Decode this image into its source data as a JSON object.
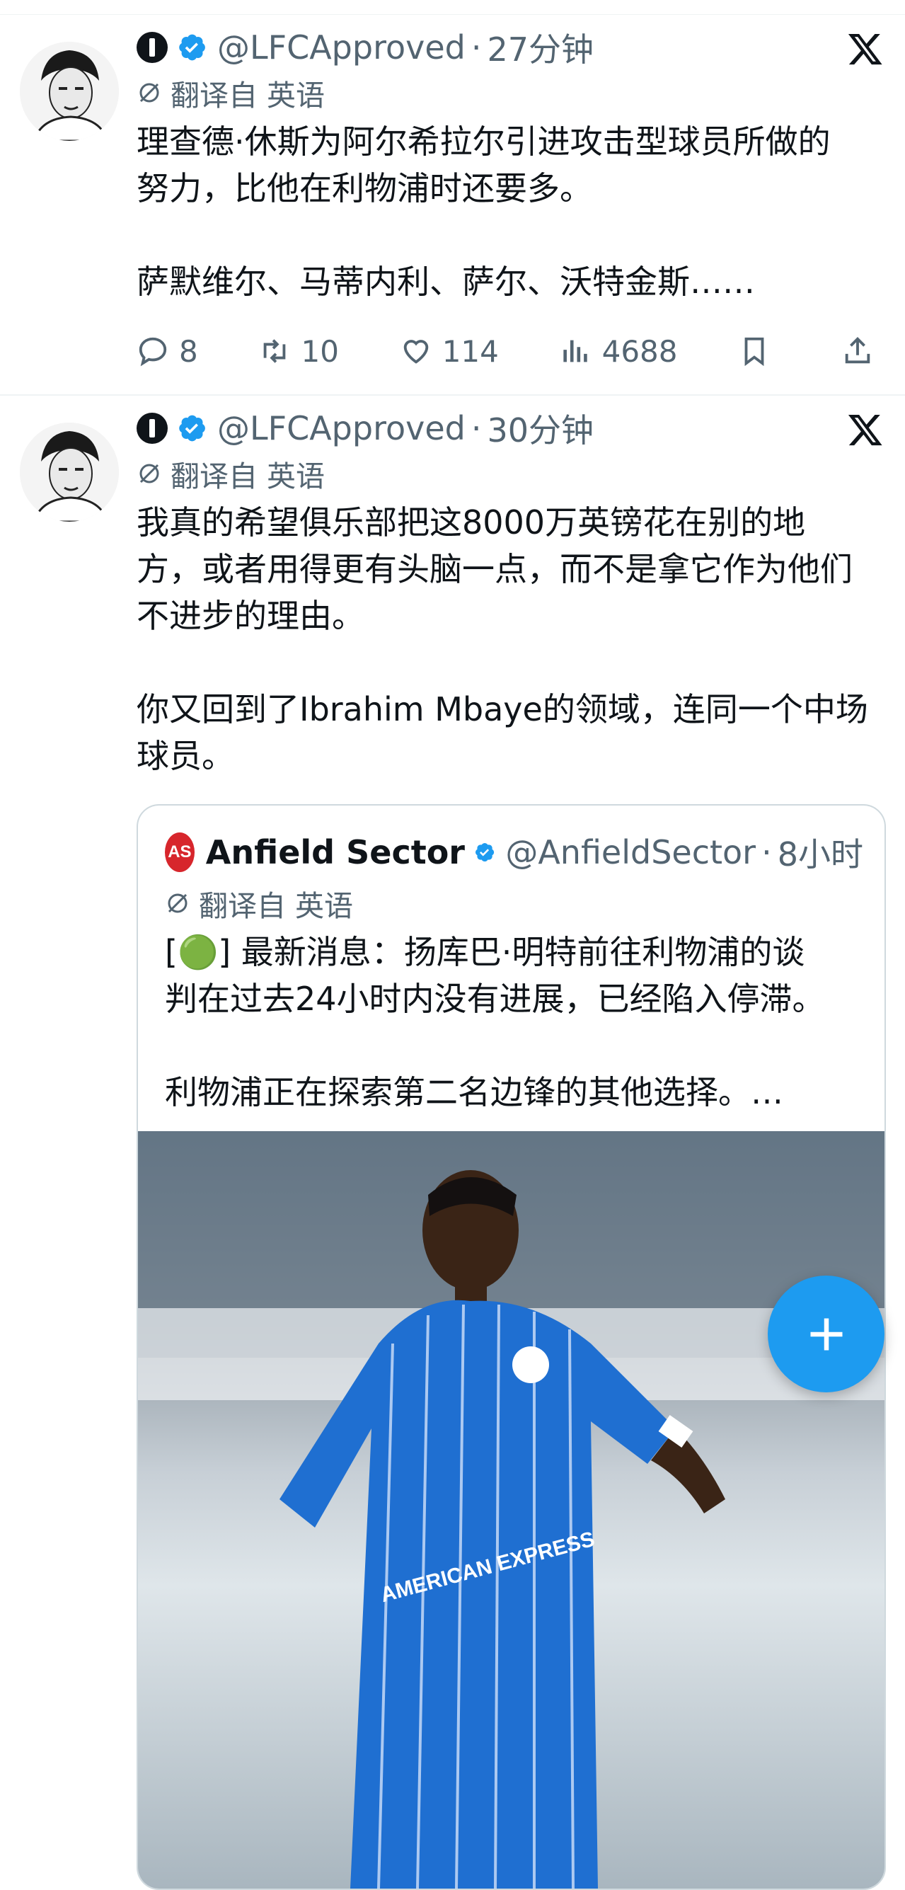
{
  "tweets": [
    {
      "handle": "@LFCApproved",
      "time": "27分钟",
      "translated": "翻译自 英语",
      "text": "理查德·休斯为阿尔希拉尔引进攻击型球员所做的\n努力，比他在利物浦时还要多。\n\n萨默维尔、马蒂内利、萨尔、沃特金斯……",
      "stats": {
        "replies": "8",
        "retweets": "10",
        "likes": "114",
        "views": "4688"
      }
    },
    {
      "handle": "@LFCApproved",
      "time": "30分钟",
      "translated": "翻译自 英语",
      "text": "我真的希望俱乐部把这8000万英镑花在别的地\n方，或者用得更有头脑一点，而不是拿它作为他们\n不进步的理由。\n\n你又回到了Ibrahim Mbaye的领域，连同一个中场\n球员。",
      "quote": {
        "logo_text": "AS",
        "name": "Anfield Sector",
        "handle": "@AnfieldSector",
        "time": "8小时",
        "translated": "翻译自 英语",
        "text": "[🟢] 最新消息：扬库巴·明特前往利物浦的谈\n判在过去24小时内没有进展，已经陷入停滞。\n\n利物浦正在探索第二名边锋的其他选择。…",
        "image_caption": "AMERICAN EXPRESS"
      }
    }
  ],
  "dot": "·",
  "fab_label": "+",
  "colors": {
    "accent": "#1d9bf0",
    "muted": "#536471",
    "text": "#0f1419"
  }
}
